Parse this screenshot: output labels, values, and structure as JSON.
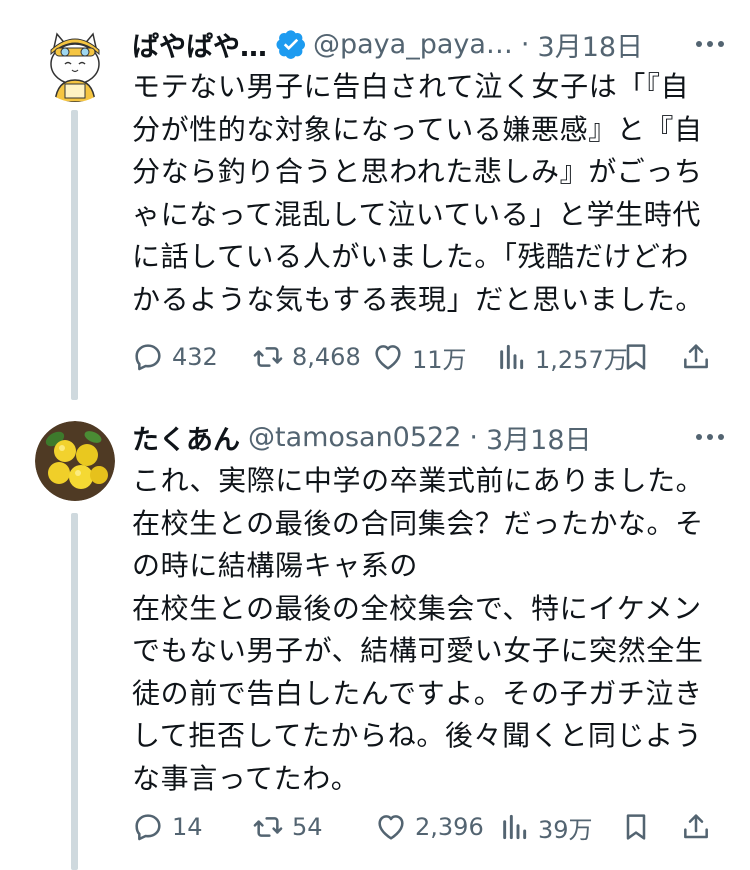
{
  "tweets": [
    {
      "display_name": "ぱやぱや…",
      "handle": "@paya_paya…",
      "dot": "·",
      "date": "3月18日",
      "verified": true,
      "avatar_icon": "cat-avatar-icon",
      "text": "モテない男子に告白されて泣く女子は「『自\n分が性的な対象になっている嫌悪感』と『自\n分なら釣り合うと思われた悲しみ』がごっち\nゃになって混乱して泣いている」と学生時代\nに話している人がいました。「残酷だけどわ\nかるような気もする表現」だと思いました。",
      "stats": {
        "replies": "432",
        "reposts": "8,468",
        "likes": "11万",
        "views": "1,257万"
      }
    },
    {
      "display_name": "たくあん",
      "handle": "@tamosan0522",
      "dot": "·",
      "date": "3月18日",
      "verified": false,
      "avatar_icon": "yuzu-fruit-avatar-icon",
      "text": "これ、実際に中学の卒業式前にありました。\n在校生との最後の合同集会？だったかな。そ\nの時に結構陽キャ系の\n在校生との最後の全校集会で、特にイケメン\nでもない男子が、結構可愛い女子に突然全生\n徒の前で告白したんですよ。その子ガチ泣き\nして拒否してたからね。後々聞くと同じよう\nな事言ってたわ。",
      "stats": {
        "replies": "14",
        "reposts": "54",
        "likes": "2,396",
        "views": "39万"
      }
    }
  ],
  "colors": {
    "text": "#0f1419",
    "secondary": "#536471",
    "verified_blue": "#1d9bf0",
    "thread_line": "#cfd9de"
  }
}
